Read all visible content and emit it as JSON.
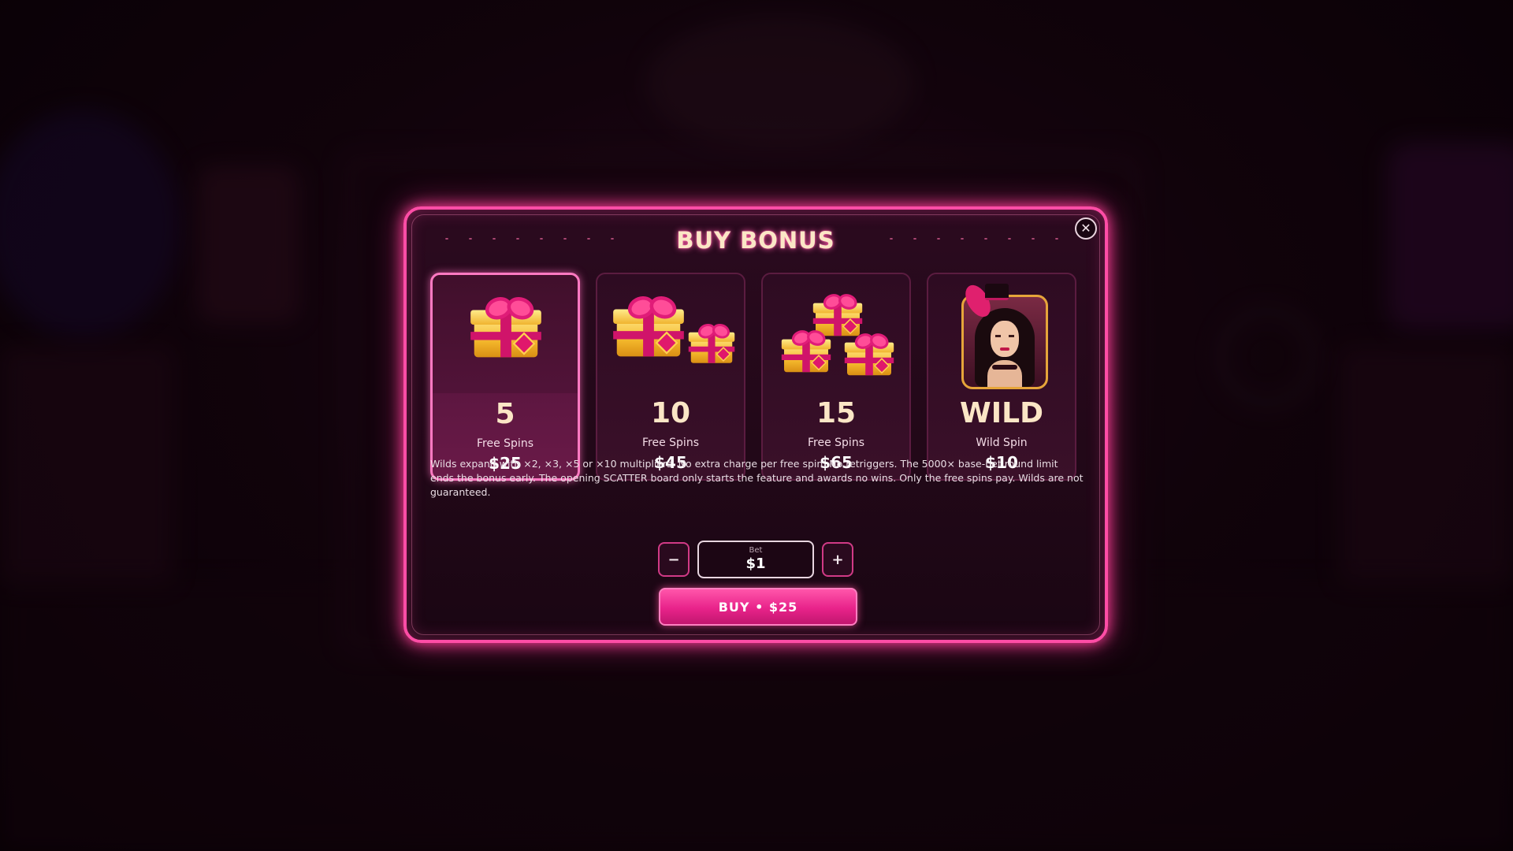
{
  "modal": {
    "title": "BUY BONUS",
    "close_icon": "close-icon"
  },
  "options": [
    {
      "count": "5",
      "label": "Free Spins",
      "price": "$25",
      "icon": "single-gift-icon",
      "selected": true
    },
    {
      "count": "10",
      "label": "Free Spins",
      "price": "$45",
      "icon": "two-gifts-icon",
      "selected": false
    },
    {
      "count": "15",
      "label": "Free Spins",
      "price": "$65",
      "icon": "gift-stack-icon",
      "selected": false
    },
    {
      "count": "WILD",
      "label": "Wild Spin",
      "price": "$10",
      "icon": "wild-lady-portrait",
      "selected": false
    }
  ],
  "description": "Wilds expand with ×2, ×3, ×5 or ×10 multipliers. No extra charge per free spin. No retriggers. The 5000× base-bet round limit ends the bonus early. The opening SCATTER board only starts the feature and awards no wins. Only the free spins pay. Wilds are not guaranteed.",
  "bet": {
    "label": "Bet",
    "value": "$1",
    "decrease_label": "−",
    "increase_label": "+"
  },
  "buy_button": {
    "label": "BUY • $25"
  },
  "colors": {
    "accent": "#ff4da6",
    "title": "#fbe6c6",
    "button": "#e8238a"
  }
}
